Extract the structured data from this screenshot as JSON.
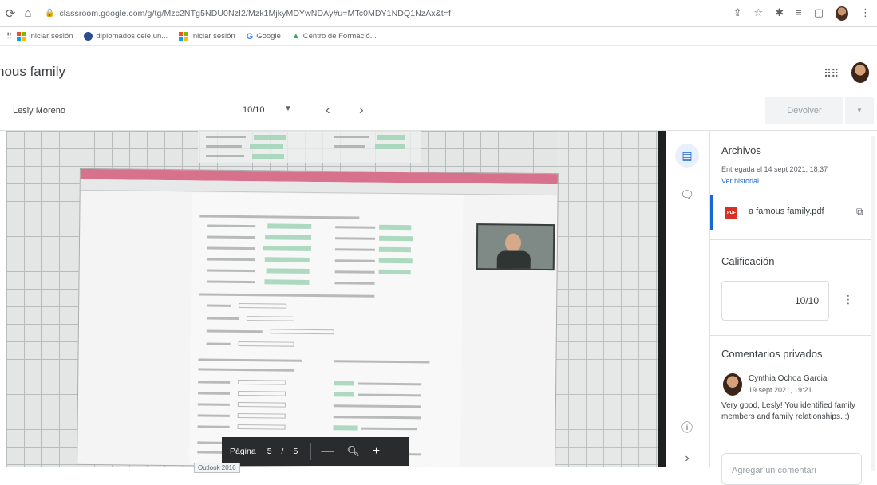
{
  "browser": {
    "url": "classroom.google.com/g/tg/Mzc2NTg5NDU0NzI2/Mzk1MjkyMDYwNDAy#u=MTc0MDY1NDQ1NzAx&t=f",
    "bookmarks": [
      {
        "label": "Iniciar sesión",
        "icon": "microsoft-icon"
      },
      {
        "label": "diplomados.cele.un...",
        "icon": "site-icon"
      },
      {
        "label": "Iniciar sesión",
        "icon": "microsoft-icon"
      },
      {
        "label": "Google",
        "icon": "google-icon"
      },
      {
        "label": "Centro de Formació...",
        "icon": "site-icon"
      }
    ]
  },
  "header": {
    "title": "nous family"
  },
  "toolbar": {
    "student": "Lesly Moreno",
    "grade_nav": "10/10",
    "return_label": "Devolver"
  },
  "viewer": {
    "page_label": "Página",
    "page_current": "5",
    "page_sep": "/",
    "page_total": "5",
    "zoom_out": "—",
    "zoom_in": "+",
    "tooltip": "Outlook 2016"
  },
  "panel": {
    "files_title": "Archivos",
    "submitted": "Entregada el 14 sept 2021, 18:37",
    "history_link": "Ver historial",
    "file_name": "a famous family.pdf",
    "pdf_badge": "PDF",
    "grade_title": "Calificación",
    "grade_value": "10/10",
    "comments_title": "Comentarios privados",
    "comment": {
      "author": "Cynthia Ochoa Garcia",
      "time": "19 sept 2021, 19:21",
      "text": "Very good, Lesly! You identified family members and family relationships. :)"
    },
    "comment_placeholder": "Agregar un comentari"
  },
  "colors": {
    "accent": "#1967d2",
    "pdf_red": "#d93025",
    "grid_bg": "#e4e6e5"
  }
}
